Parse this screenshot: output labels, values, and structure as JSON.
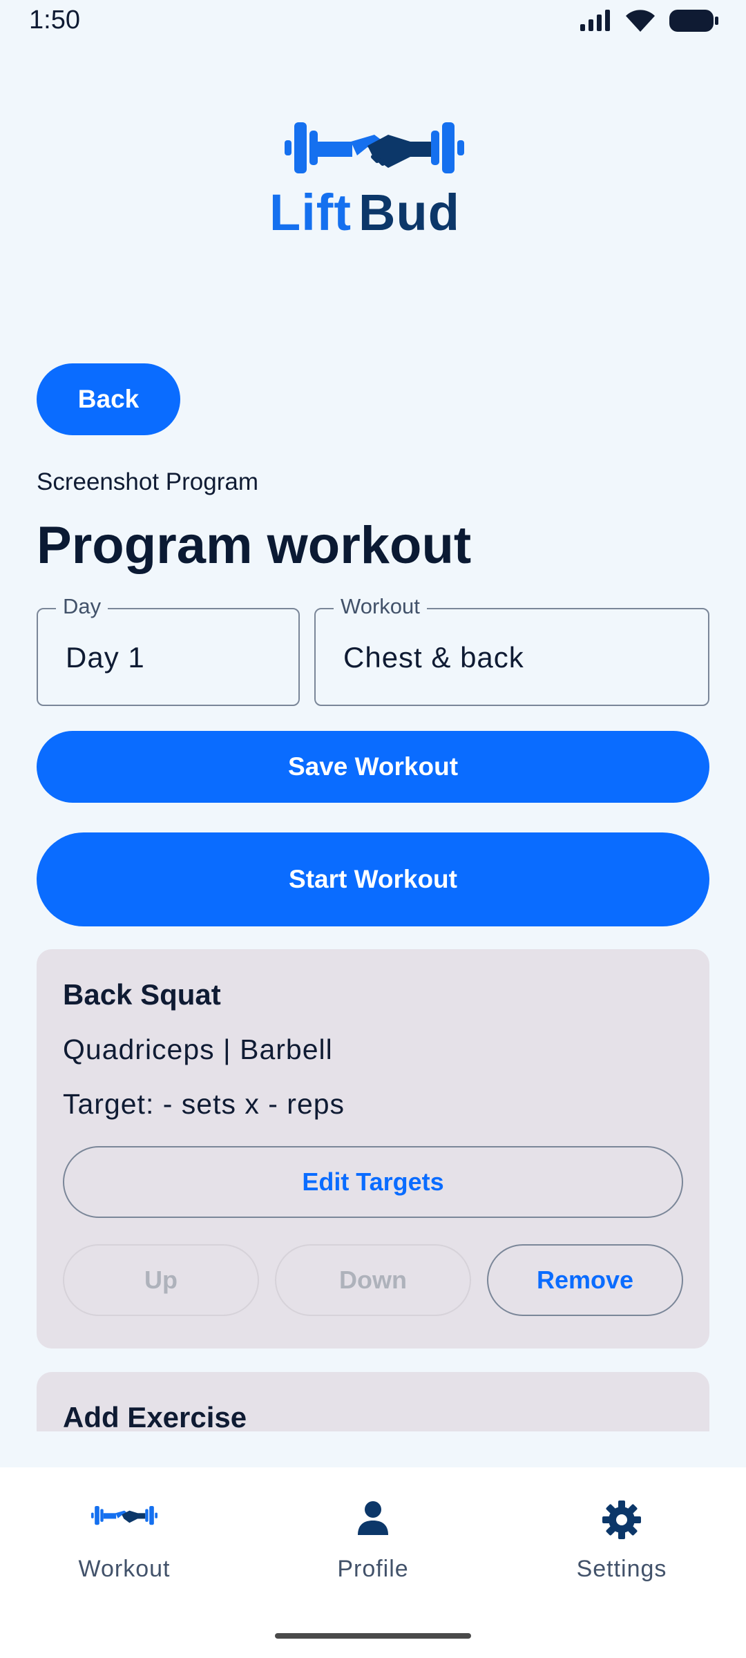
{
  "status_bar": {
    "time": "1:50"
  },
  "brand": {
    "name_part1": "Lift",
    "name_part2": "Bud",
    "primary_color": "#1570ef",
    "dark_color": "#0c3769"
  },
  "header": {
    "back_label": "Back",
    "program_name": "Screenshot Program",
    "title": "Program workout"
  },
  "form": {
    "day": {
      "label": "Day",
      "value": "Day 1"
    },
    "workout": {
      "label": "Workout",
      "value": "Chest & back"
    }
  },
  "actions": {
    "save_label": "Save Workout",
    "start_label": "Start Workout"
  },
  "exercises": [
    {
      "name": "Back Squat",
      "muscle_equipment": "Quadriceps | Barbell",
      "target": "Target: - sets x - reps",
      "edit_label": "Edit Targets",
      "up_label": "Up",
      "down_label": "Down",
      "remove_label": "Remove"
    }
  ],
  "add_exercise": {
    "title": "Add Exercise"
  },
  "nav": {
    "items": [
      {
        "label": "Workout",
        "icon": "dumbbell-handshake-icon",
        "active": true
      },
      {
        "label": "Profile",
        "icon": "person-icon",
        "active": false
      },
      {
        "label": "Settings",
        "icon": "gear-icon",
        "active": false
      }
    ]
  },
  "colors": {
    "accent": "#0a6cff",
    "background": "#f1f7fc",
    "card": "#e5e1e8"
  }
}
